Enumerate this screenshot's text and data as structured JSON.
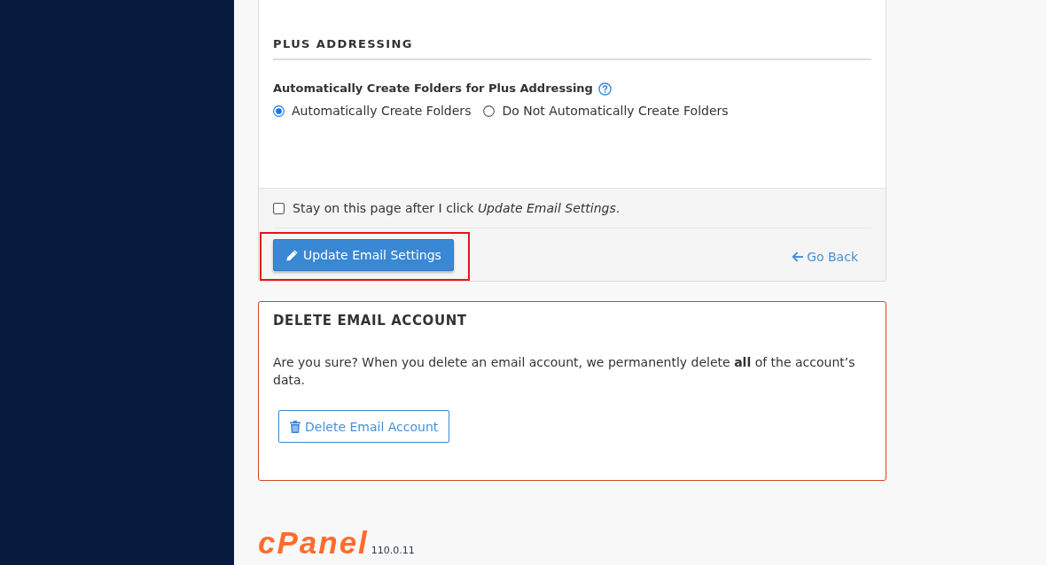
{
  "plus_addressing": {
    "heading": "PLUS ADDRESSING",
    "field_label": "Automatically Create Folders for Plus Addressing",
    "options": [
      {
        "label": "Automatically Create Folders",
        "selected": true
      },
      {
        "label": "Do Not Automatically Create Folders",
        "selected": false
      }
    ]
  },
  "form_footer": {
    "stay_checkbox": {
      "label": "Stay on this page after I click *Update Email Settings*.",
      "checked": false
    },
    "submit_button": {
      "label": "Update Email Settings",
      "highlighted": true
    },
    "back_link": "Go Back"
  },
  "delete_section": {
    "heading": "DELETE EMAIL ACCOUNT",
    "message": "Are you sure? When you delete an email account, we permanently delete **all** of the account’s data.",
    "button": "Delete Email Account"
  },
  "footer": {
    "logo": "cPanel",
    "version": "110.0.11"
  }
}
